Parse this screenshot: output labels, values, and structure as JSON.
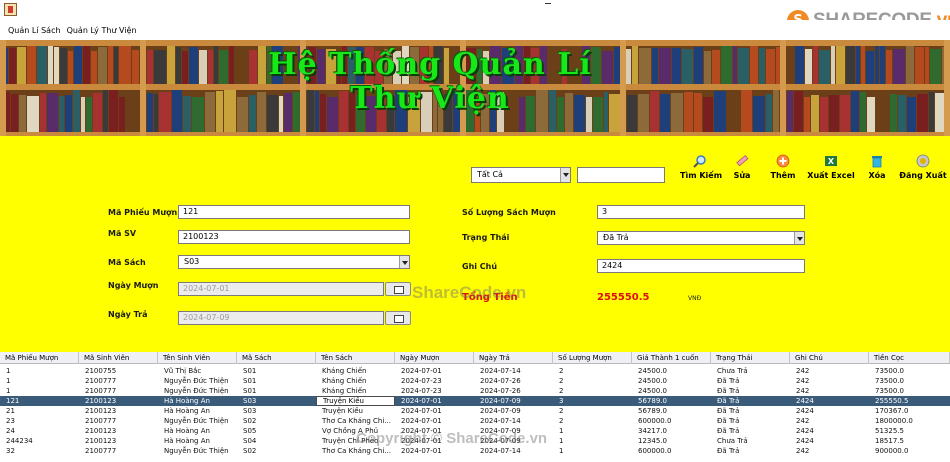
{
  "menu": [
    "Quản Lí Sách",
    "Quản Lý Thư Viện"
  ],
  "brand": {
    "main": "SHARECODE",
    "suffix": ".vn"
  },
  "banner": {
    "line1": "Hệ Thống Quản Lí",
    "line2": "Thư Viện"
  },
  "search": {
    "filter_value": "Tất Cả",
    "query": ""
  },
  "toolbar": {
    "search": "Tìm Kiếm",
    "edit": "Sửa",
    "add": "Thêm",
    "excel": "Xuất Excel",
    "delete": "Xóa",
    "logout": "Đăng Xuất"
  },
  "form": {
    "ma_phieu_label": "Mã Phiếu Mượn",
    "ma_phieu_value": "121",
    "ma_sv_label": "Mã SV",
    "ma_sv_value": "2100123",
    "ma_sach_label": "Mã Sách",
    "ma_sach_value": "S03",
    "ngay_muon_label": "Ngày Mượn",
    "ngay_muon_value": "2024-07-01",
    "ngay_tra_label": "Ngày Trả",
    "ngay_tra_value": "2024-07-09",
    "so_luong_label": "Số Lượng Sách Mượn",
    "so_luong_value": "3",
    "trang_thai_label": "Trạng Thái",
    "trang_thai_value": "Đã Trả",
    "ghi_chu_label": "Ghi Chú",
    "ghi_chu_value": "2424"
  },
  "total": {
    "label": "Tổng Tiền",
    "value": "255550.5",
    "unit": "VNĐ"
  },
  "watermarks": {
    "center": "ShareCode.vn",
    "bottom": "Copyright © ShareCode.vn"
  },
  "colors": {
    "panel": "#ffff00",
    "banner_title": "#18e818",
    "total": "#e01010",
    "selected_row": "#3b5b7a"
  },
  "table": {
    "columns": [
      "Mã Phiếu Mượn",
      "Mã Sinh Viên",
      "Tên Sinh Viên",
      "Mã Sách",
      "Tên Sách",
      "Ngày Mượn",
      "Ngày Trả",
      "Số Lượng Mượn",
      "Giá Thành 1 cuốn",
      "Trạng Thái",
      "Ghi Chú",
      "Tiền Cọc"
    ],
    "rows": [
      [
        "1",
        "2100755",
        "Vũ Thị Bắc",
        "S01",
        "Kháng Chiến",
        "2024-07-01",
        "2024-07-14",
        "2",
        "24500.0",
        "Chưa Trả",
        "242",
        "73500.0"
      ],
      [
        "1",
        "2100777",
        "Nguyễn Đức Thiện",
        "S01",
        "Kháng Chiến",
        "2024-07-23",
        "2024-07-26",
        "2",
        "24500.0",
        "Đã Trả",
        "242",
        "73500.0"
      ],
      [
        "1",
        "2100777",
        "Nguyễn Đức Thiện",
        "S01",
        "Kháng Chiến",
        "2024-07-23",
        "2024-07-26",
        "2",
        "24500.0",
        "Đã Trả",
        "242",
        "73500.0"
      ],
      [
        "121",
        "2100123",
        "Hà Hoàng An",
        "S03",
        "Truyện Kiều",
        "2024-07-01",
        "2024-07-09",
        "3",
        "56789.0",
        "Đã Trả",
        "2424",
        "255550.5"
      ],
      [
        "21",
        "2100123",
        "Hà Hoàng An",
        "S03",
        "Truyện Kiều",
        "2024-07-01",
        "2024-07-09",
        "2",
        "56789.0",
        "Đã Trả",
        "2424",
        "170367.0"
      ],
      [
        "23",
        "2100777",
        "Nguyễn Đức Thiện",
        "S02",
        "Thơ Ca Kháng Chi...",
        "2024-07-01",
        "2024-07-14",
        "2",
        "600000.0",
        "Đã Trả",
        "242",
        "1800000.0"
      ],
      [
        "24",
        "2100123",
        "Hà Hoàng An",
        "S05",
        "Vợ Chồng A Phủ",
        "2024-07-01",
        "2024-07-09",
        "1",
        "34217.0",
        "Đã Trả",
        "2424",
        "51325.5"
      ],
      [
        "244234",
        "2100123",
        "Hà Hoàng An",
        "S04",
        "Truyện Chí Phèo",
        "2024-07-01",
        "2024-07-09",
        "1",
        "12345.0",
        "Chưa Trả",
        "2424",
        "18517.5"
      ],
      [
        "32",
        "2100777",
        "Nguyễn Đức Thiện",
        "S02",
        "Thơ Ca Kháng Chi...",
        "2024-07-01",
        "2024-07-14",
        "1",
        "600000.0",
        "Đã Trả",
        "242",
        "900000.0"
      ]
    ],
    "selected_index": 3
  }
}
